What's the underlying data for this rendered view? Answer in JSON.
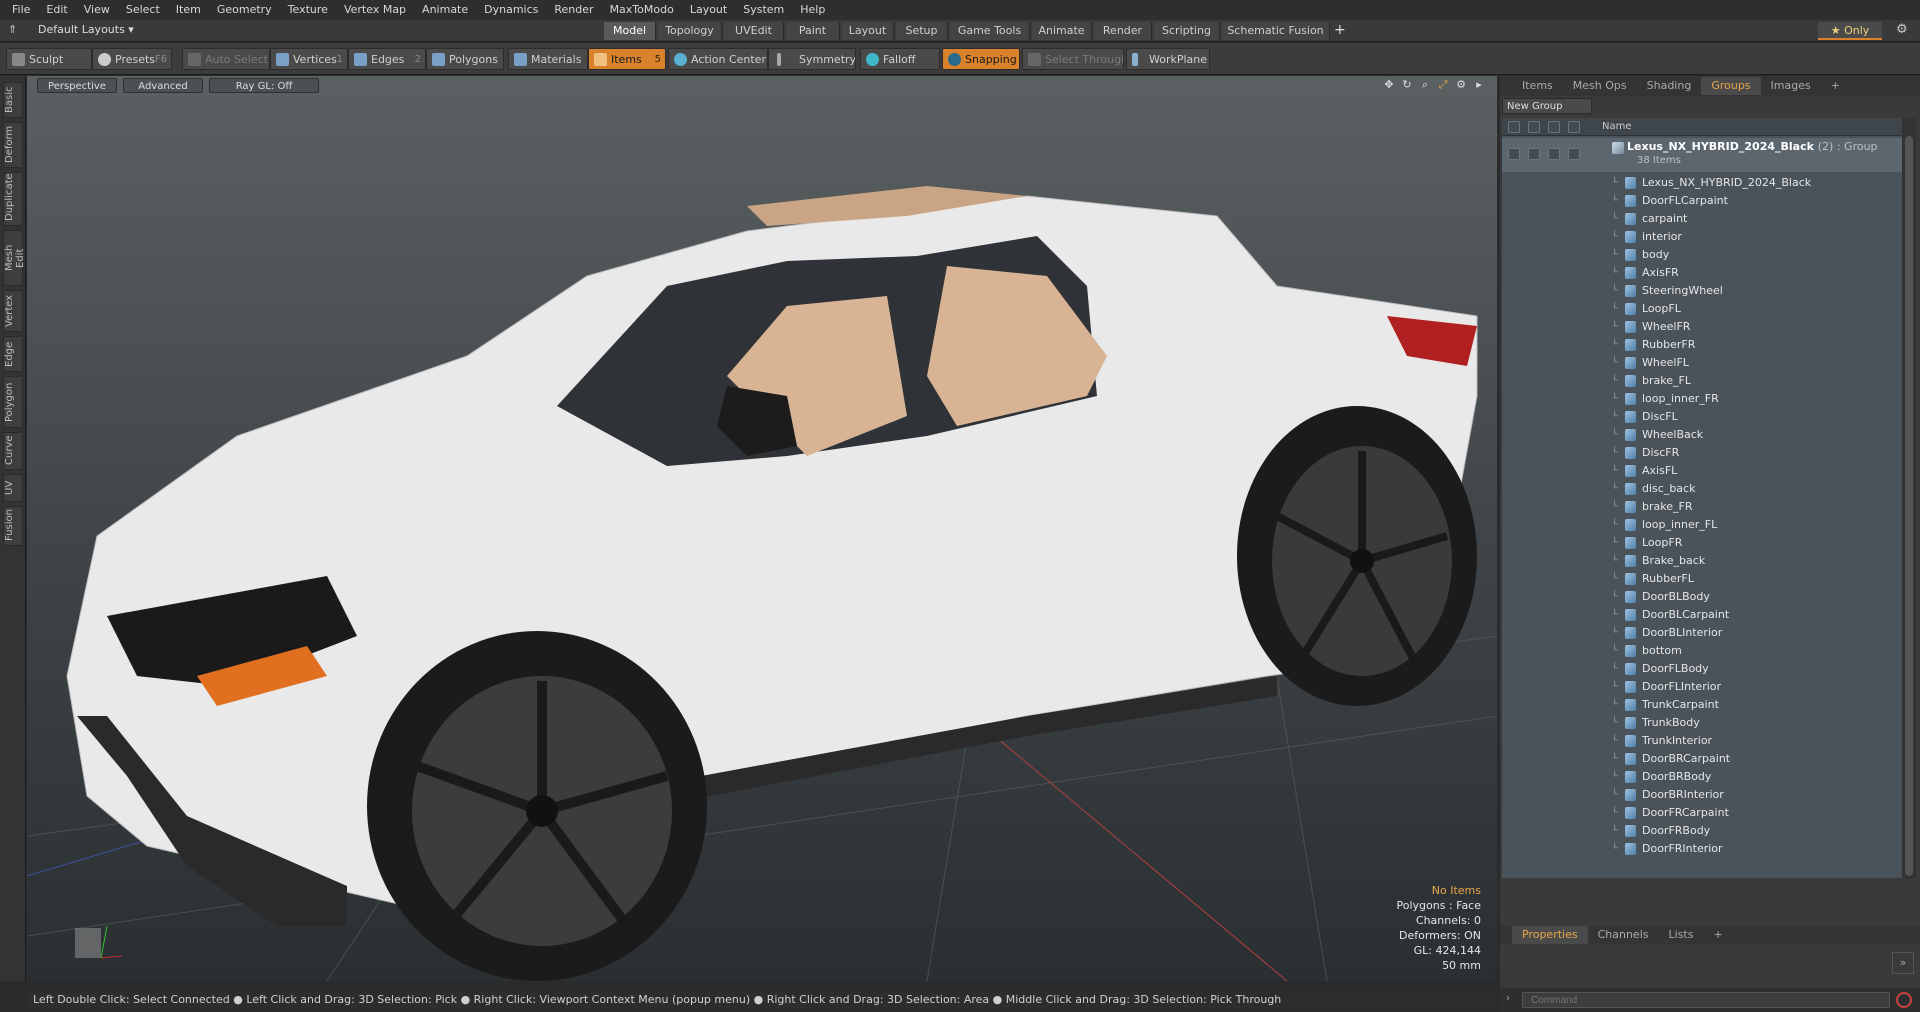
{
  "menu": [
    "File",
    "Edit",
    "View",
    "Select",
    "Item",
    "Geometry",
    "Texture",
    "Vertex Map",
    "Animate",
    "Dynamics",
    "Render",
    "MaxToModo",
    "Layout",
    "System",
    "Help"
  ],
  "layouts": {
    "label": "Default Layouts ▾",
    "tabs": [
      "Model",
      "Topology",
      "UVEdit",
      "Paint",
      "Layout",
      "Setup",
      "Game Tools",
      "Animate",
      "Render",
      "Scripting",
      "Schematic Fusion"
    ],
    "add": "+",
    "only": "★ Only"
  },
  "toolbar": {
    "sculpt": "Sculpt",
    "presets": "Presets",
    "presets_key": "F6",
    "auto_select": "Auto Select",
    "vertices": "Vertices",
    "vertices_cnt": "1",
    "edges": "Edges",
    "edges_cnt": "2",
    "polygons": "Polygons",
    "materials": "Materials",
    "items": "Items",
    "items_cnt": "5",
    "action_center": "Action Center",
    "symmetry": "Symmetry",
    "falloff": "Falloff",
    "snapping": "Snapping",
    "select_through": "Select Through",
    "workplane": "WorkPlane"
  },
  "lefttabs": [
    "Basic",
    "Deform",
    "Duplicate",
    "Mesh Edit",
    "Vertex",
    "Edge",
    "Polygon",
    "Curve",
    "UV",
    "Fusion"
  ],
  "viewport": {
    "view": "Perspective",
    "shading": "Advanced",
    "raygl": "Ray GL: Off",
    "hud": {
      "selection": "No Items",
      "mode": "Polygons : Face",
      "channels": "Channels: 0",
      "deformers": "Deformers: ON",
      "gl": "GL: 424,144",
      "focal": "50 mm"
    }
  },
  "status": "Left Double Click: Select Connected ● Left Click and Drag: 3D Selection: Pick ● Right Click: Viewport Context Menu (popup menu) ● Right Click and Drag: 3D Selection: Area ● Middle Click and Drag: 3D Selection: Pick Through",
  "panel": {
    "tabs": [
      "Items",
      "Mesh Ops",
      "Shading",
      "Groups",
      "Images",
      "+"
    ],
    "new_group": "New Group",
    "name_col": "Name",
    "group": {
      "name": "Lexus_NX_HYBRID_2024_Black",
      "tag": "(2) : Group",
      "count": "38 Items"
    },
    "items": [
      "Lexus_NX_HYBRID_2024_Black",
      "DoorFLCarpaint",
      "carpaint",
      "interior",
      "body",
      "AxisFR",
      "SteeringWheel",
      "LoopFL",
      "WheelFR",
      "RubberFR",
      "WheelFL",
      "brake_FL",
      "loop_inner_FR",
      "DiscFL",
      "WheelBack",
      "DiscFR",
      "AxisFL",
      "disc_back",
      "brake_FR",
      "loop_inner_FL",
      "LoopFR",
      "Brake_back",
      "RubberFL",
      "DoorBLBody",
      "DoorBLCarpaint",
      "DoorBLInterior",
      "bottom",
      "DoorFLBody",
      "DoorFLInterior",
      "TrunkCarpaint",
      "TrunkBody",
      "TrunkInterior",
      "DoorBRCarpaint",
      "DoorBRBody",
      "DoorBRInterior",
      "DoorFRCarpaint",
      "DoorFRBody",
      "DoorFRInterior"
    ],
    "bottom_tabs": [
      "Properties",
      "Channels",
      "Lists",
      "+"
    ],
    "command_placeholder": "Command"
  },
  "colors": {
    "accent": "#d9822b",
    "selected_tab": "#e8a64a"
  }
}
